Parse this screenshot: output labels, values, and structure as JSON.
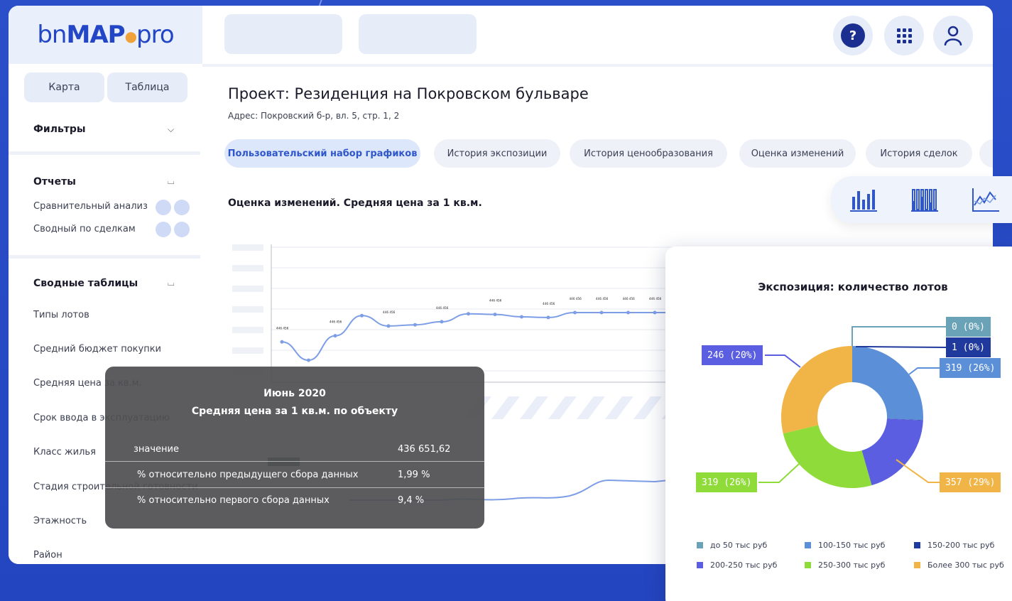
{
  "app": {
    "logo_prefix": "bn",
    "logo_main": "MAP",
    "logo_suffix": "pro"
  },
  "sidebar": {
    "view_toggle": [
      "Карта",
      "Таблица"
    ],
    "filters_title": "Фильтры",
    "reports_title": "Отчеты",
    "reports": [
      "Сравнительный анализ",
      "Сводный по сделкам"
    ],
    "pivot_title": "Сводные таблицы",
    "pivot_items": [
      "Типы лотов",
      "Средний бюджет покупки",
      "Средняя цена за кв.м.",
      "Срок ввода в эксплуатацию",
      "Класс жилья",
      "Стадия строительной готовности",
      "Этажность",
      "Район"
    ]
  },
  "topbar": {
    "help_symbol": "?",
    "icons": [
      "help-icon",
      "apps-grid-icon",
      "user-icon"
    ]
  },
  "project": {
    "title": "Проект: Резиденция на Покровском бульваре",
    "address": "Адрес: Покровский б-р, вл. 5, стр. 1, 2"
  },
  "tabs": [
    "Пользовательский набор графиков",
    "История экспозиции",
    "История ценообразования",
    "Оценка изменений",
    "История сделок"
  ],
  "chart_section_title": "Оценка изменений. Средняя цена за 1 кв.м.",
  "tooltip": {
    "period": "Июнь 2020",
    "subtitle": "Средняя цена за 1 кв.м. по объекту",
    "rows": [
      {
        "label": "значение",
        "value": "436 651,62"
      },
      {
        "label": "% относительно предыдущего сбора данных",
        "value": "1,99 %"
      },
      {
        "label": "% относительно первого сбора данных",
        "value": "9,4 %"
      }
    ]
  },
  "chart_types": [
    "bar-chart-icon",
    "stacked-bar-chart-icon",
    "line-chart-icon"
  ],
  "colors": {
    "accent": "#2f57c9",
    "brand_dark": "#1a2f8f",
    "background": "#2a4fc9"
  },
  "chart_data": [
    {
      "type": "line",
      "title": "Оценка изменений. Средняя цена за 1 кв.м.",
      "x": [
        0,
        1,
        2,
        3,
        4,
        5,
        6,
        7,
        8,
        9,
        10,
        11,
        12,
        13,
        14,
        15,
        16,
        17,
        18,
        19,
        20,
        21,
        22
      ],
      "series": [
        {
          "values": [
            0.52,
            0.22,
            0.62,
            0.95,
            0.78,
            0.8,
            0.85,
            0.98,
            0.97,
            0.93,
            0.92,
            1.0,
            1.0,
            1.0,
            1.0,
            1.0,
            1.0,
            1.1,
            1.1,
            1.12,
            1.12,
            1.14,
            1.14
          ]
        }
      ],
      "point_label": "446 456",
      "grid": true
    },
    {
      "type": "pie",
      "title": "Экспозиция: количество лотов",
      "categories": [
        "до 50 тыс руб",
        "100-150 тыс руб",
        "150-200 тыс руб",
        "200-250 тыс руб",
        "250-300 тыс руб",
        "Более 300 тыс руб"
      ],
      "values": [
        0,
        319,
        1,
        246,
        319,
        357
      ],
      "labels": [
        "0 (0%)",
        "319 (26%)",
        "1 (0%)",
        "246 (20%)",
        "319 (26%)",
        "357 (29%)"
      ],
      "colors": [
        "#6aa3b8",
        "#5b8fd8",
        "#1f3a9c",
        "#5b5ee0",
        "#8fdb3a",
        "#f0b447"
      ],
      "legend": "bottom"
    }
  ]
}
